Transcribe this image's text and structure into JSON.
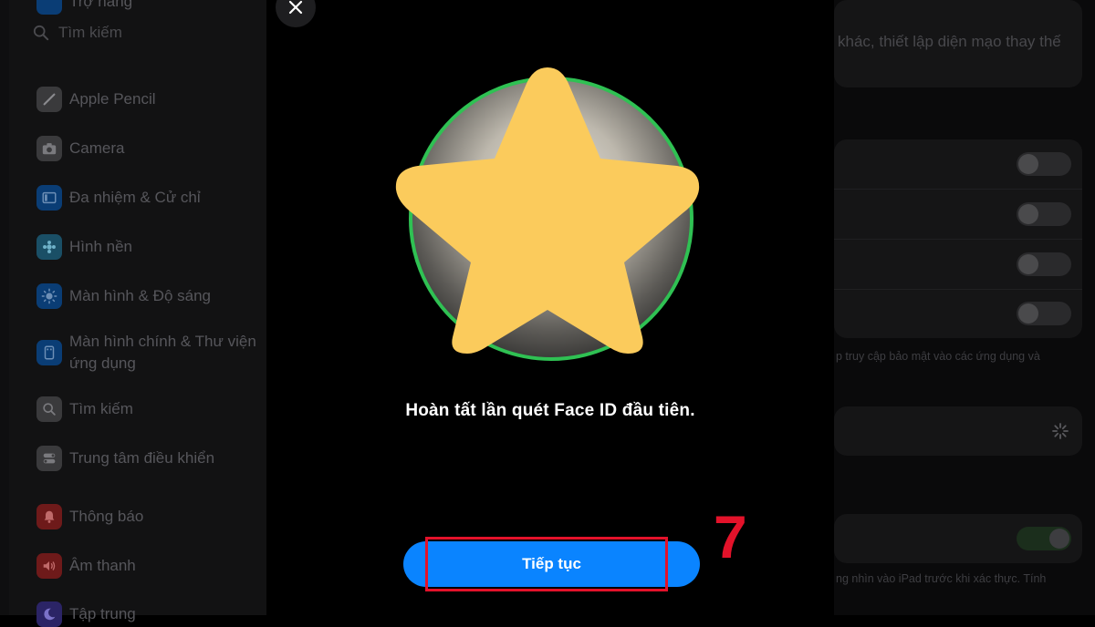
{
  "sidebar": {
    "top_item_partial": "Trợ năng",
    "search_placeholder": "Tìm kiếm",
    "items": [
      {
        "label": "Apple Pencil",
        "icon": "pencil-icon",
        "color": "#3a3a3c"
      },
      {
        "label": "Camera",
        "icon": "camera-icon",
        "color": "#3a3a3c"
      },
      {
        "label": "Đa nhiệm & Cử chỉ",
        "icon": "multitasking-icon",
        "color": "#0a3d75"
      },
      {
        "label": "Hình nền",
        "icon": "wallpaper-icon",
        "color": "#1a4f66"
      },
      {
        "label": "Màn hình & Độ sáng",
        "icon": "brightness-icon",
        "color": "#0a3d75"
      },
      {
        "label": "Màn hình chính & Thư viện ứng dụng",
        "icon": "home-screen-icon",
        "color": "#0a3d75"
      },
      {
        "label": "Tìm kiếm",
        "icon": "search-icon",
        "color": "#3a3a3c"
      },
      {
        "label": "Trung tâm điều khiển",
        "icon": "control-center-icon",
        "color": "#3a3a3c"
      },
      {
        "label": "Thông báo",
        "icon": "notification-icon",
        "color": "#6e1a1a"
      },
      {
        "label": "Âm thanh",
        "icon": "sound-icon",
        "color": "#6e1a1a"
      },
      {
        "label": "Tập trung",
        "icon": "focus-icon",
        "color": "#2b2466"
      }
    ]
  },
  "right_panel": {
    "top_text": "khác, thiết lập diện mạo thay thế",
    "security_footer": "p truy cập bảo mật vào các ứng dụng và",
    "attention_footer": "ng nhìn vào iPad trước khi xác thực. Tính",
    "toggles": [
      false,
      false,
      false,
      false
    ],
    "attention_toggle": true
  },
  "modal": {
    "message": "Hoàn tất lần quét Face ID đầu tiên.",
    "continue_label": "Tiếp tục"
  },
  "annotation": {
    "step_number": "7",
    "color": "#e3122a"
  },
  "colors": {
    "accent_blue": "#0a84ff",
    "scan_ring_green": "#2fc153",
    "star_yellow": "#fbcb5c"
  }
}
